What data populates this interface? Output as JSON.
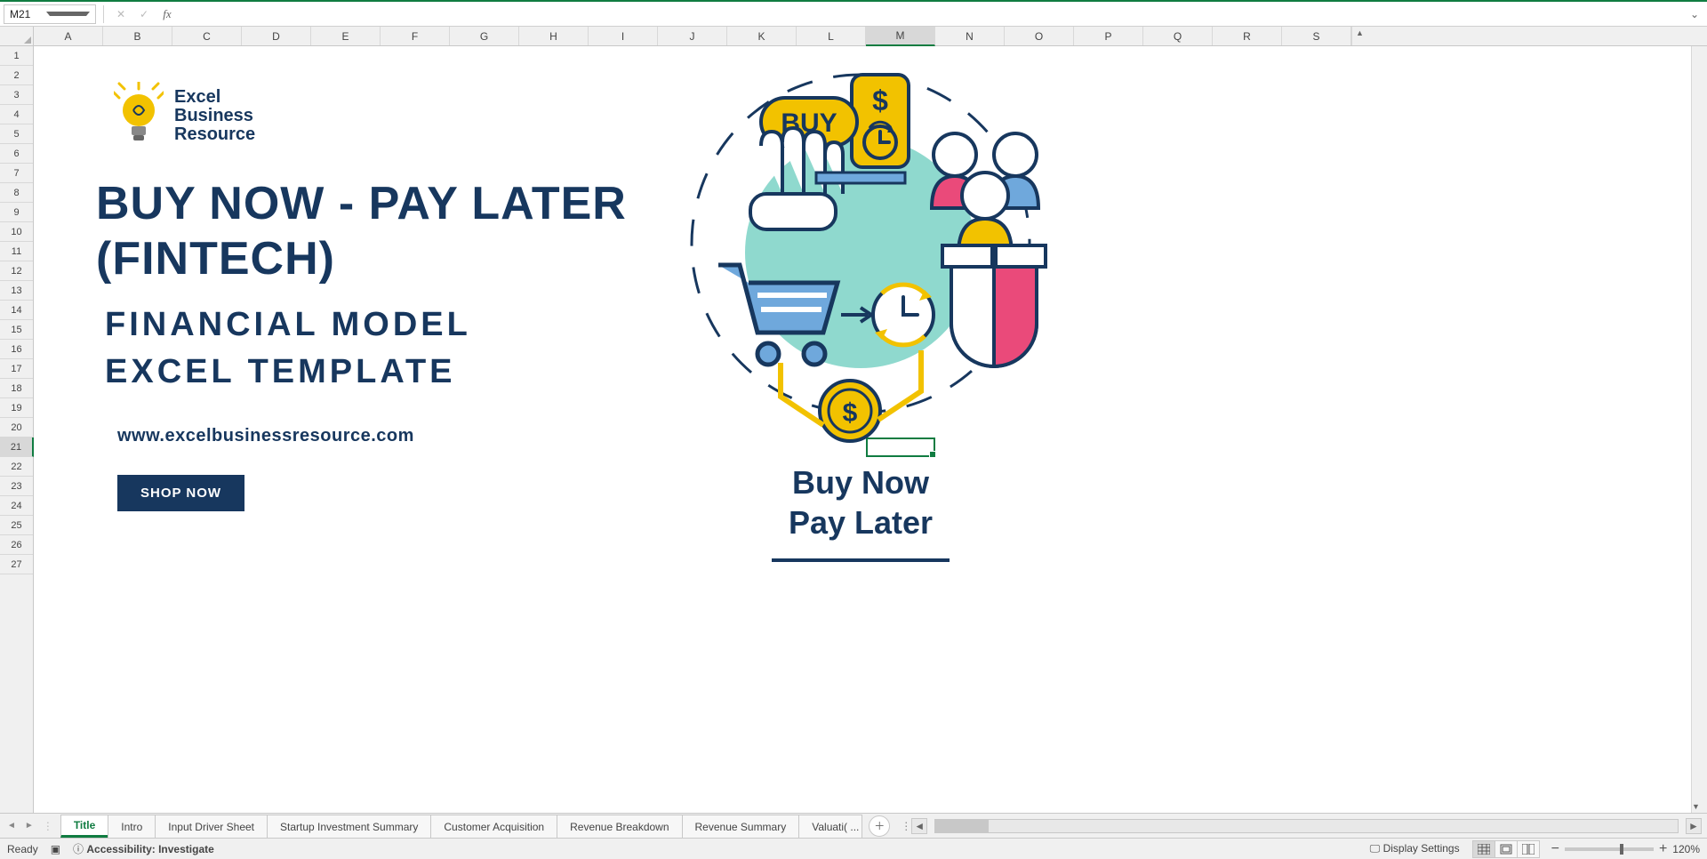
{
  "namebox": "M21",
  "formula": "",
  "columns": [
    "A",
    "B",
    "C",
    "D",
    "E",
    "F",
    "G",
    "H",
    "I",
    "J",
    "K",
    "L",
    "M",
    "N",
    "O",
    "P",
    "Q",
    "R",
    "S"
  ],
  "selected_col": "M",
  "rows": [
    1,
    2,
    3,
    4,
    5,
    6,
    7,
    8,
    9,
    10,
    11,
    12,
    13,
    14,
    15,
    16,
    17,
    18,
    19,
    20,
    21,
    22,
    23,
    24,
    25,
    26,
    27
  ],
  "selected_row": 21,
  "logo": {
    "l1": "Excel",
    "l2": "Business",
    "l3": "Resource"
  },
  "title_line1": "BUY NOW - PAY LATER",
  "title_line2": "(FINTECH)",
  "subtitle_line1": "FINANCIAL MODEL",
  "subtitle_line2": "EXCEL TEMPLATE",
  "url": "www.excelbusinessresource.com",
  "shop_btn": "SHOP NOW",
  "slogan_l1": "Buy Now",
  "slogan_l2": "Pay Later",
  "buy_label": "BUY",
  "tabs": [
    "Title",
    "Intro",
    "Input Driver Sheet",
    "Startup Investment Summary",
    "Customer Acquisition",
    "Revenue Breakdown",
    "Revenue Summary",
    "Valuati( ..."
  ],
  "active_tab": 0,
  "status_ready": "Ready",
  "accessibility": "Accessibility: Investigate",
  "display_settings": "Display Settings",
  "zoom": "120%"
}
